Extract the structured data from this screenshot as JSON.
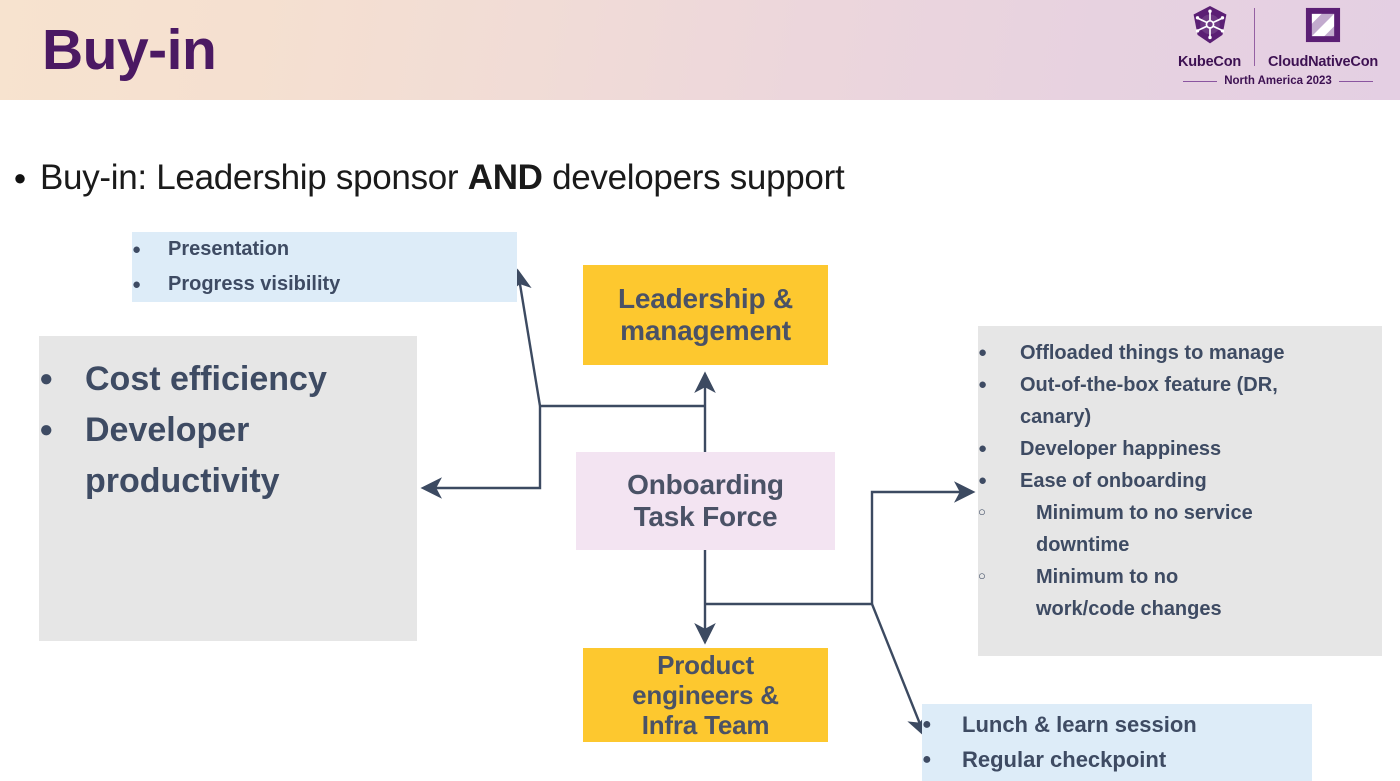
{
  "header": {
    "title": "Buy-in",
    "logo": {
      "left_name": "KubeCon",
      "right_name": "CloudNativeCon",
      "subtitle": "North America 2023"
    }
  },
  "main_bullet": {
    "prefix": "Buy-in: Leadership sponsor ",
    "emphasis": "AND",
    "suffix": " developers support"
  },
  "diagram": {
    "nodes": {
      "leadership": {
        "label_line1": "Leadership &",
        "label_line2": "management"
      },
      "task_force": {
        "label_line1": "Onboarding",
        "label_line2": "Task Force"
      },
      "engineers": {
        "label_line1": "Product",
        "label_line2": "engineers &",
        "label_line3": "Infra Team"
      }
    },
    "cards": {
      "presentation": {
        "items": [
          "Presentation",
          "Progress visibility"
        ]
      },
      "benefits_left": {
        "items": [
          "Cost efficiency",
          "Developer productivity"
        ]
      },
      "benefits_right": {
        "items": [
          "Offloaded things to manage",
          "Out-of-the-box feature (DR, canary)",
          "Developer happiness",
          "Ease of onboarding"
        ],
        "subitems": [
          "Minimum to no service downtime",
          "Minimum to no work/code changes"
        ]
      },
      "engagement": {
        "items": [
          "Lunch & learn session",
          "Regular checkpoint"
        ]
      }
    }
  },
  "colors": {
    "title": "#4b1963",
    "yellow": "#fdc82f",
    "pink": "#f3e4f2",
    "gray": "#e6e6e6",
    "blue": "#ddecf8",
    "ink": "#3e4b63",
    "connector": "#3c4a61"
  },
  "glyphs": {
    "bullet_filled": "●",
    "bullet_hollow": "○"
  }
}
